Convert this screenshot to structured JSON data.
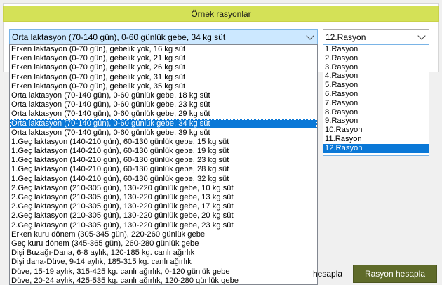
{
  "header": {
    "title": "Örnek rasyonlar"
  },
  "ration_select": {
    "selected": "Orta laktasyon (70-140 gün), 0-60 günlük gebe, 34 kg süt",
    "options": [
      "Erken laktasyon (0-70 gün), gebelik yok, 16 kg süt",
      "Erken laktasyon (0-70 gün), gebelik yok, 21 kg süt",
      "Erken laktasyon (0-70 gün), gebelik yok, 26 kg süt",
      "Erken laktasyon (0-70 gün), gebelik yok, 31 kg süt",
      "Erken laktasyon (0-70 gün), gebelik yok, 35 kg süt",
      "Orta laktasyon (70-140 gün), 0-60 günlük gebe, 18 kg süt",
      "Orta laktasyon (70-140 gün), 0-60 günlük gebe, 23 kg süt",
      "Orta laktasyon (70-140 gün), 0-60 günlük gebe, 29 kg süt",
      "Orta laktasyon (70-140 gün), 0-60 günlük gebe, 34 kg süt",
      "Orta laktasyon (70-140 gün), 0-60 günlük gebe, 39 kg süt",
      "1.Geç laktasyon (140-210 gün), 60-130 günlük gebe, 15 kg süt",
      "1.Geç laktasyon (140-210 gün), 60-130 günlük gebe, 19 kg süt",
      "1.Geç laktasyon (140-210 gün), 60-130 günlük gebe, 23 kg süt",
      "1.Geç laktasyon (140-210 gün), 60-130 günlük gebe, 28 kg süt",
      "1.Geç laktasyon (140-210 gün), 60-130 günlük gebe, 32 kg süt",
      "2.Geç laktasyon (210-305 gün), 130-220 günlük gebe, 10 kg süt",
      "2.Geç laktasyon (210-305 gün), 130-220 günlük gebe, 13 kg süt",
      "2.Geç laktasyon (210-305 gün), 130-220 günlük gebe, 17 kg süt",
      "2.Geç laktasyon (210-305 gün), 130-220 günlük gebe, 20 kg süt",
      "2.Geç laktasyon (210-305 gün), 130-220 günlük gebe, 23 kg süt",
      "Erken kuru dönem (305-345 gün), 220-260 günlük gebe",
      "Geç kuru dönem (345-365 gün), 260-280 günlük gebe",
      "Dişi Buzağı-Dana, 6-8 aylık, 120-185 kg. canlı ağırlık",
      "Dişi dana-Düve, 9-14 aylık, 185-315 kg. canlı ağırlık",
      "Düve, 15-19 aylık, 315-425 kg. canlı ağırlık, 0-120 günlük gebe",
      "Düve, 20-24 aylık, 425-535 kg. canlı ağırlık, 120-280 günlük gebe"
    ],
    "selected_index": 8
  },
  "rasyon_select": {
    "selected": "12.Rasyon",
    "options": [
      "1.Rasyon",
      "2.Rasyon",
      "3.Rasyon",
      "4.Rasyon",
      "5.Rasyon",
      "6.Rasyon",
      "7.Rasyon",
      "8.Rasyon",
      "9.Rasyon",
      "10.Rasyon",
      "11.Rasyon",
      "12.Rasyon"
    ],
    "selected_index": 11
  },
  "buttons": {
    "partial_label": "hesapla",
    "rasyon_hesapla": "Rasyon hesapla"
  },
  "colors": {
    "title_bg": "#d4e157",
    "selection": "#0a78d7",
    "button_bg": "#5f6b2a"
  }
}
